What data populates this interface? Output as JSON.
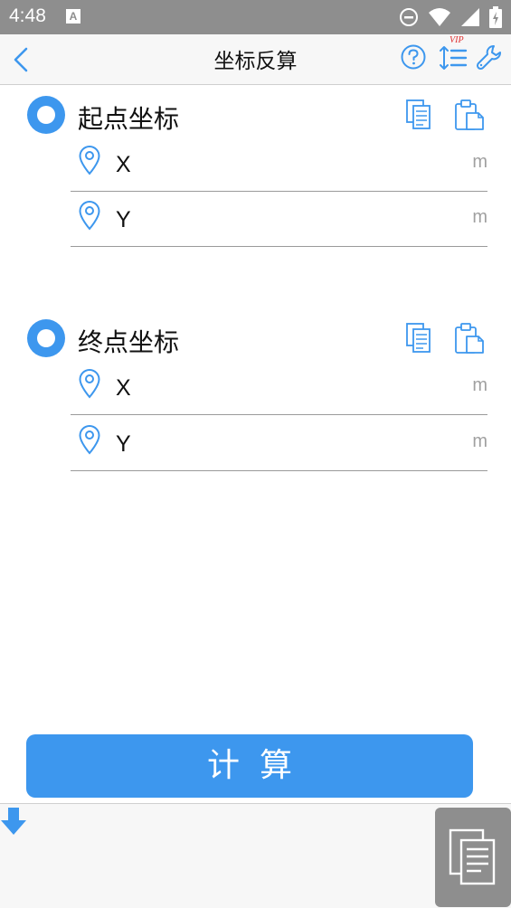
{
  "status_bar": {
    "time": "4:48",
    "notification_icon_letter": "A",
    "icons": [
      "do-not-disturb-icon",
      "wifi-icon",
      "signal-icon",
      "battery-charging-icon"
    ]
  },
  "toolbar": {
    "title": "坐标反算",
    "vip_badge": "VIP",
    "icons": [
      "back-icon",
      "help-icon",
      "sort-icon",
      "wrench-icon"
    ]
  },
  "start_section": {
    "title": "起点坐标",
    "fields": [
      {
        "label": "X",
        "value": "",
        "unit": "m"
      },
      {
        "label": "Y",
        "value": "",
        "unit": "m"
      }
    ]
  },
  "end_section": {
    "title": "终点坐标",
    "fields": [
      {
        "label": "X",
        "value": "",
        "unit": "m"
      },
      {
        "label": "Y",
        "value": "",
        "unit": "m"
      }
    ]
  },
  "calculate_button": {
    "label": "计算"
  },
  "colors": {
    "accent": "#3d97ee",
    "status_bar": "#8e8e8e",
    "toolbar_bg": "#f7f7f7",
    "vip": "#e03030",
    "unit_text": "#a0a0a0"
  }
}
